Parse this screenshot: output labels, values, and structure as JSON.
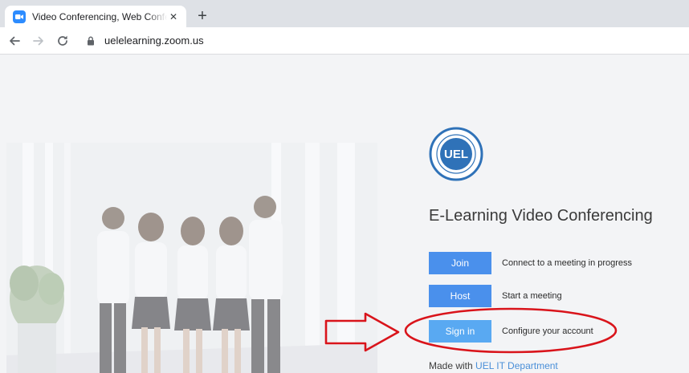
{
  "browser": {
    "tab": {
      "title": "Video Conferencing, Web Conferencing, Webinars, Screen Sharing - Zoom",
      "close_label": "✕"
    },
    "new_tab_label": "+",
    "url": "uelelearning.zoom.us"
  },
  "page": {
    "headline": "E-Learning Video Conferencing",
    "logo_text": "UEL",
    "actions": [
      {
        "button": "Join",
        "description": "Connect to a meeting in progress"
      },
      {
        "button": "Host",
        "description": "Start a meeting"
      },
      {
        "button": "Sign in",
        "description": "Configure your account"
      }
    ],
    "footer": {
      "prefix": "Made with",
      "link": "UEL IT Department"
    }
  },
  "colors": {
    "button_blue": "#4a90ec",
    "signin_blue": "#59a9f2",
    "annotation_red": "#d9141b"
  },
  "icons": [
    "zoom-favicon",
    "close-icon",
    "plus-icon",
    "back-arrow-icon",
    "forward-arrow-icon",
    "reload-icon",
    "lock-icon",
    "uel-logo"
  ]
}
